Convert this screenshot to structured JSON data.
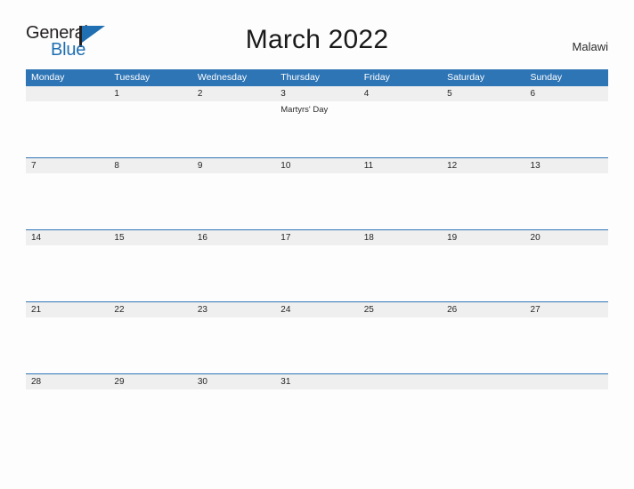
{
  "brand": {
    "name_top": "General",
    "name_bottom": "Blue",
    "accent_color": "#1f6fb2"
  },
  "header": {
    "title": "March 2022",
    "country": "Malawi"
  },
  "calendar": {
    "header_color": "#2e75b6",
    "date_band_color": "#efefef",
    "weekdays": [
      "Monday",
      "Tuesday",
      "Wednesday",
      "Thursday",
      "Friday",
      "Saturday",
      "Sunday"
    ],
    "weeks": [
      {
        "days": [
          {
            "date": "",
            "event": ""
          },
          {
            "date": "1",
            "event": ""
          },
          {
            "date": "2",
            "event": ""
          },
          {
            "date": "3",
            "event": "Martyrs' Day"
          },
          {
            "date": "4",
            "event": ""
          },
          {
            "date": "5",
            "event": ""
          },
          {
            "date": "6",
            "event": ""
          }
        ]
      },
      {
        "days": [
          {
            "date": "7",
            "event": ""
          },
          {
            "date": "8",
            "event": ""
          },
          {
            "date": "9",
            "event": ""
          },
          {
            "date": "10",
            "event": ""
          },
          {
            "date": "11",
            "event": ""
          },
          {
            "date": "12",
            "event": ""
          },
          {
            "date": "13",
            "event": ""
          }
        ]
      },
      {
        "days": [
          {
            "date": "14",
            "event": ""
          },
          {
            "date": "15",
            "event": ""
          },
          {
            "date": "16",
            "event": ""
          },
          {
            "date": "17",
            "event": ""
          },
          {
            "date": "18",
            "event": ""
          },
          {
            "date": "19",
            "event": ""
          },
          {
            "date": "20",
            "event": ""
          }
        ]
      },
      {
        "days": [
          {
            "date": "21",
            "event": ""
          },
          {
            "date": "22",
            "event": ""
          },
          {
            "date": "23",
            "event": ""
          },
          {
            "date": "24",
            "event": ""
          },
          {
            "date": "25",
            "event": ""
          },
          {
            "date": "26",
            "event": ""
          },
          {
            "date": "27",
            "event": ""
          }
        ]
      },
      {
        "days": [
          {
            "date": "28",
            "event": ""
          },
          {
            "date": "29",
            "event": ""
          },
          {
            "date": "30",
            "event": ""
          },
          {
            "date": "31",
            "event": ""
          },
          {
            "date": "",
            "event": ""
          },
          {
            "date": "",
            "event": ""
          },
          {
            "date": "",
            "event": ""
          }
        ]
      }
    ]
  }
}
